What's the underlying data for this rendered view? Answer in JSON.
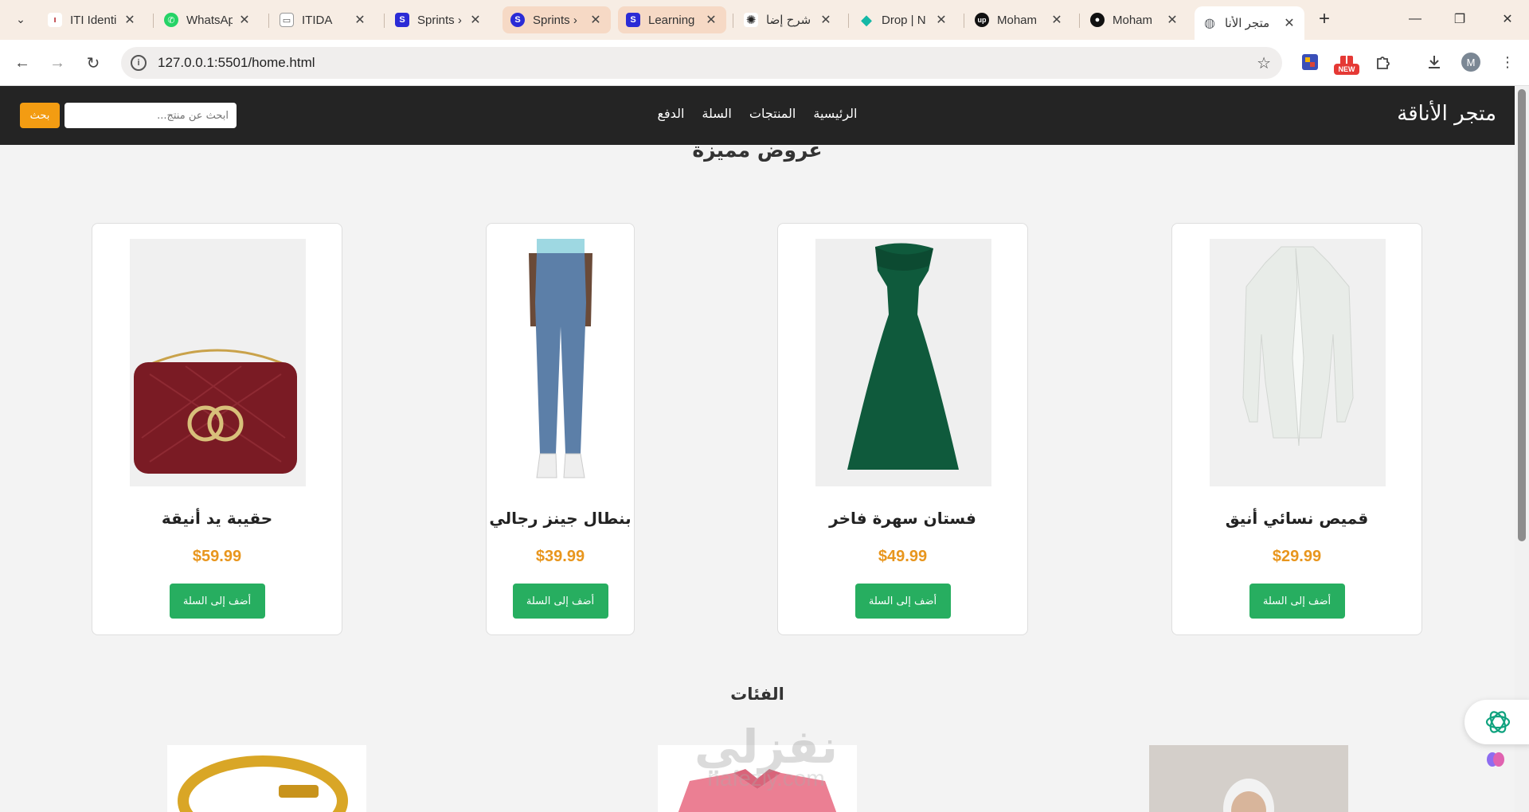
{
  "browser": {
    "tabs": [
      {
        "title": "ITI Identi",
        "fav_color": "#b5262c",
        "fav_text": "ıŁı"
      },
      {
        "title": "WhatsAp",
        "fav_color": "#25d366",
        "fav_text": "✆"
      },
      {
        "title": "ITIDA",
        "fav_color": "#ffffff",
        "fav_text": "▭"
      },
      {
        "title": "Sprints ›",
        "fav_color": "#2b2bd6",
        "fav_text": "S"
      },
      {
        "title": "Sprints ›",
        "fav_color": "#2b2bd6",
        "fav_text": "S"
      },
      {
        "title": "Learning",
        "fav_color": "#2b2bd6",
        "fav_text": "S"
      },
      {
        "title": "شرح إضا",
        "fav_color": "#ffffff",
        "fav_text": "✺"
      },
      {
        "title": "Drop | N",
        "fav_color": "#14b8a6",
        "fav_text": "◆"
      },
      {
        "title": "Moham",
        "fav_color": "#111111",
        "fav_text": "up"
      },
      {
        "title": "Moham",
        "fav_color": "#111111",
        "fav_text": "●"
      },
      {
        "title": "متجر الأنا",
        "fav_color": "#5f6368",
        "fav_text": "◍"
      }
    ],
    "url": "127.0.0.1:5501/home.html",
    "ext_new_label": "NEW",
    "avatar_letter": "M"
  },
  "site": {
    "brand": "متجر الأناقة",
    "nav": [
      "الرئيسية",
      "المنتجات",
      "السلة",
      "الدفع"
    ],
    "search_placeholder": "ابحث عن منتج...",
    "search_button": "بحث",
    "featured_title": "عروض مميزة",
    "categories_title": "الفئات",
    "add_to_cart": "أضف إلى السلة",
    "products": [
      {
        "name": "قميص نسائي أنيق",
        "price": "$29.99",
        "image": "white-blouse"
      },
      {
        "name": "فستان سهرة فاخر",
        "price": "$49.99",
        "image": "green-gown"
      },
      {
        "name": "بنطال جينز رجالي",
        "price": "$39.99",
        "image": "blue-jeans"
      },
      {
        "name": "حقيبة يد أنيقة",
        "price": "$59.99",
        "image": "red-handbag"
      }
    ],
    "categories": [
      {
        "image": "woman-portrait"
      },
      {
        "image": "pink-shirt"
      },
      {
        "image": "gold-bracelet"
      }
    ]
  },
  "watermark": {
    "ar": "نفزلي",
    "en": "nafezly.com"
  }
}
